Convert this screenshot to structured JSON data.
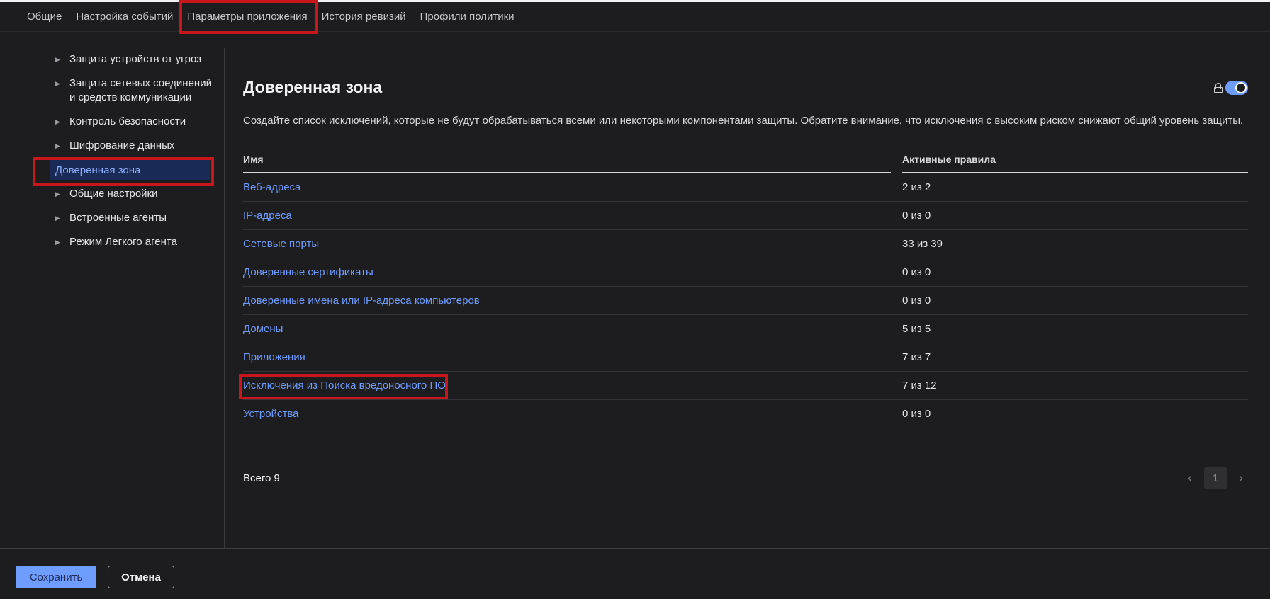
{
  "tabs": [
    {
      "label": "Общие"
    },
    {
      "label": "Настройка событий"
    },
    {
      "label": "Параметры приложения"
    },
    {
      "label": "История ревизий"
    },
    {
      "label": "Профили политики"
    }
  ],
  "sidebar": {
    "items": [
      {
        "label": "Защита устройств от угроз"
      },
      {
        "label": "Защита сетевых соединений"
      },
      {
        "label": "и средств коммуникации"
      },
      {
        "label": "Контроль безопасности"
      },
      {
        "label": "Шифрование данных"
      },
      {
        "label": "Доверенная зона"
      },
      {
        "label": "Общие настройки"
      },
      {
        "label": "Встроенные агенты"
      },
      {
        "label": "Режим Легкого агента"
      }
    ]
  },
  "main": {
    "title": "Доверенная зона",
    "description": "Создайте список исключений, которые не будут обрабатываться всеми или некоторыми компонентами защиты. Обратите внимание, что исключения с высоким риском снижают общий уровень защиты.",
    "columns": {
      "name": "Имя",
      "rules": "Активные правила"
    },
    "rows": [
      {
        "name": "Веб-адреса",
        "rules": "2 из 2"
      },
      {
        "name": "IP-адреса",
        "rules": "0 из 0"
      },
      {
        "name": "Сетевые порты",
        "rules": "33 из 39"
      },
      {
        "name": "Доверенные сертификаты",
        "rules": "0 из 0"
      },
      {
        "name": "Доверенные имена или IP-адреса компьютеров",
        "rules": "0 из 0"
      },
      {
        "name": "Домены",
        "rules": "5 из 5"
      },
      {
        "name": "Приложения",
        "rules": "7 из 7"
      },
      {
        "name": "Исключения из Поиска вредоносного ПО",
        "rules": "7 из 12"
      },
      {
        "name": "Устройства",
        "rules": "0 из 0"
      }
    ],
    "total": "Всего 9",
    "pager": {
      "current_page": "1",
      "prev_icon": "chevron-left-icon",
      "next_icon": "chevron-right-icon"
    },
    "toggle_on": true
  },
  "footer": {
    "save_label": "Сохранить",
    "cancel_label": "Отмена"
  },
  "colors": {
    "accent": "#6f9cff",
    "highlight": "#c8161d",
    "background": "#1d1d20"
  }
}
